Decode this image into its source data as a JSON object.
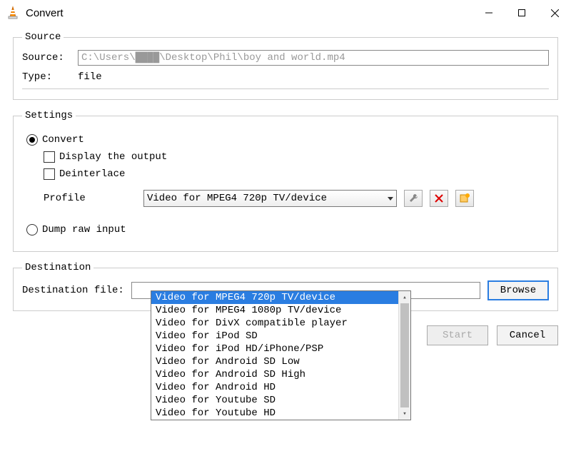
{
  "window": {
    "title": "Convert"
  },
  "source": {
    "legend": "Source",
    "source_label": "Source:",
    "source_value": "C:\\Users\\████\\Desktop\\Phil\\boy and world.mp4",
    "type_label": "Type:",
    "type_value": "file"
  },
  "settings": {
    "legend": "Settings",
    "convert_label": "Convert",
    "display_label": "Display the output",
    "deinterlace_label": "Deinterlace",
    "profile_label": "Profile",
    "profile_selected": "Video for MPEG4 720p TV/device",
    "profile_options": [
      "Video for MPEG4 720p TV/device",
      "Video for MPEG4 1080p TV/device",
      "Video for DivX compatible player",
      "Video for iPod SD",
      "Video for iPod HD/iPhone/PSP",
      "Video for Android SD Low",
      "Video for Android SD High",
      "Video for Android HD",
      "Video for Youtube SD",
      "Video for Youtube HD"
    ],
    "dump_label": "Dump raw input"
  },
  "destination": {
    "legend": "Destination",
    "file_label": "Destination file:",
    "file_value": "",
    "browse_label": "Browse"
  },
  "footer": {
    "start_label": "Start",
    "cancel_label": "Cancel"
  }
}
